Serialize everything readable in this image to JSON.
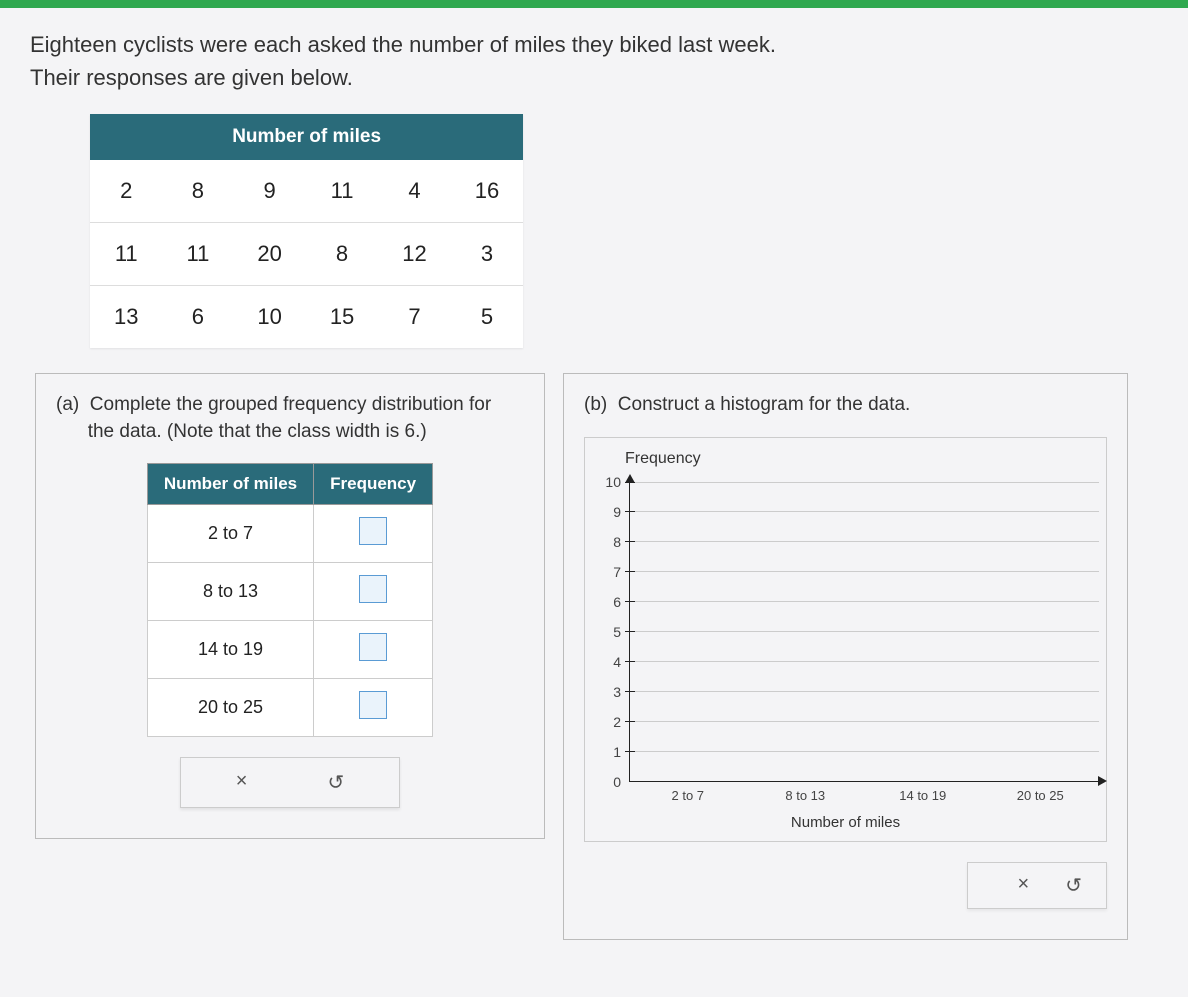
{
  "prompt_line1": "Eighteen cyclists were each asked the number of miles they biked last week.",
  "prompt_line2": "Their responses are given below.",
  "data_table_header": "Number of miles",
  "data_values": [
    [
      "2",
      "8",
      "9",
      "11",
      "4",
      "16"
    ],
    [
      "11",
      "11",
      "20",
      "8",
      "12",
      "3"
    ],
    [
      "13",
      "6",
      "10",
      "15",
      "7",
      "5"
    ]
  ],
  "part_a": {
    "label": "(a)",
    "text1": "Complete the grouped frequency distribution for",
    "text2": "the data. (Note that the class width is 6.)",
    "col1": "Number of miles",
    "col2": "Frequency",
    "classes": [
      "2 to 7",
      "8 to 13",
      "14 to 19",
      "20 to 25"
    ],
    "x_icon": "×",
    "reset_icon": "↺"
  },
  "part_b": {
    "label": "(b)",
    "text": "Construct a histogram for the data.",
    "ylabel": "Frequency",
    "xlabel": "Number of miles",
    "y_ticks": [
      "10",
      "9",
      "8",
      "7",
      "6",
      "5",
      "4",
      "3",
      "2",
      "1",
      "0"
    ],
    "x_ticks": [
      "2 to 7",
      "8 to 13",
      "14 to 19",
      "20 to 25"
    ],
    "x_icon": "×",
    "reset_icon": "↺"
  },
  "chart_data": {
    "type": "bar",
    "categories": [
      "2 to 7",
      "8 to 13",
      "14 to 19",
      "20 to 25"
    ],
    "values": [
      null,
      null,
      null,
      null
    ],
    "title": "Frequency",
    "xlabel": "Number of miles",
    "ylabel": "Frequency",
    "ylim": [
      0,
      10
    ]
  }
}
